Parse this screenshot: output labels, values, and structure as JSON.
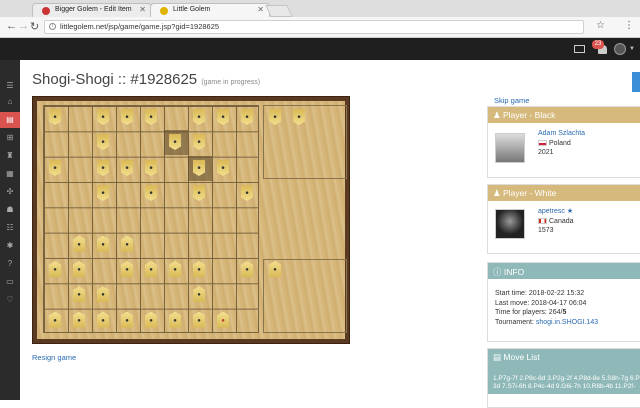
{
  "browser": {
    "tabs": [
      {
        "title": "Bigger Golem - Edit Item"
      },
      {
        "title": "Little Golem"
      }
    ],
    "url": "littlegolem.net/jsp/game/game.jsp?gid=1928625"
  },
  "topbar": {
    "notification_count": "23"
  },
  "page": {
    "title": "Shogi-Shogi :: #1928625",
    "status": "(game in progress)",
    "resign_link": "Resign game",
    "skip_link": "Skip game"
  },
  "player_black": {
    "header": "Player - Black",
    "name": "Adam Szlachta",
    "country": "Poland",
    "rating": "2021"
  },
  "player_white": {
    "header": "Player - White",
    "name": "apetresc",
    "country": "Canada",
    "rating": "1573"
  },
  "info": {
    "header": "INFO",
    "start_time": "Start time: 2018-02-22 15:32",
    "last_move": "Last move: 2018-04-17 06:04",
    "time_for_players_label": "Time for players: 264/",
    "time_for_players_value": "5",
    "tournament_label": "Tournament: ",
    "tournament_link": "shogi.in.SHOGI.143"
  },
  "movelist": {
    "header": "Move List",
    "line1": "1.P7g-7f 2.P8c-8d 3.P2g-2f 4.P8d-8e 5.S8h-7g 6.P3c-3",
    "line2": "3d 7.S7i-6h 8.P4c-4d 9.G6i-7h 10.R8b-4b 11.P2f-"
  },
  "colors": {
    "accent_red": "#d9534f",
    "panel_tan": "#d6b97c",
    "panel_teal": "#8fb8b8",
    "link_blue": "#2a6bb0"
  }
}
